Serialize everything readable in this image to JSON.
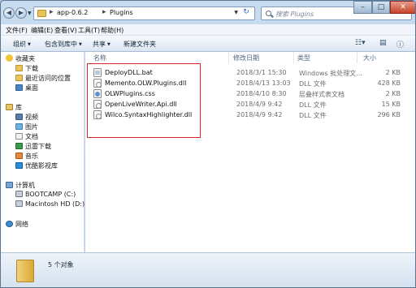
{
  "window": {
    "breadcrumb": [
      "app-0.6.2",
      "Plugins"
    ],
    "search_placeholder": "搜索 Plugins"
  },
  "menu": [
    "文件(F)",
    "编辑(E)",
    "查看(V)",
    "工具(T)",
    "帮助(H)"
  ],
  "toolbar": {
    "organize": "组织",
    "include_library": "包含到库中",
    "share": "共享",
    "new_folder": "新建文件夹"
  },
  "nav": {
    "favorites": "收藏夹",
    "downloads": "下载",
    "recent": "最近访问的位置",
    "desktop": "桌面",
    "libraries": "库",
    "videos": "视频",
    "pictures": "图片",
    "documents": "文档",
    "xunlei": "迅雷下载",
    "music": "音乐",
    "youku": "优酷影视库",
    "computer": "计算机",
    "bootcamp": "BOOTCAMP (C:)",
    "macintosh": "Macintosh HD (D:)",
    "network": "网络"
  },
  "columns": {
    "name": "名称",
    "date": "修改日期",
    "type": "类型",
    "size": "大小"
  },
  "files": [
    {
      "name": "DeployDLL.bat",
      "date": "2018/3/1 15:30",
      "type": "Windows 批处理文...",
      "size": "2 KB",
      "icon": "bat"
    },
    {
      "name": "Memento.OLW.Plugins.dll",
      "date": "2018/4/13 13:03",
      "type": "DLL 文件",
      "size": "428 KB",
      "icon": "dll"
    },
    {
      "name": "OLWPlugins.css",
      "date": "2018/4/10 8:30",
      "type": "层叠样式表文档",
      "size": "2 KB",
      "icon": "css"
    },
    {
      "name": "OpenLiveWriter.Api.dll",
      "date": "2018/4/9 9:42",
      "type": "DLL 文件",
      "size": "15 KB",
      "icon": "dll"
    },
    {
      "name": "Wilco.SyntaxHighlighter.dll",
      "date": "2018/4/9 9:42",
      "type": "DLL 文件",
      "size": "296 KB",
      "icon": "dll"
    }
  ],
  "status": "5 个对象"
}
